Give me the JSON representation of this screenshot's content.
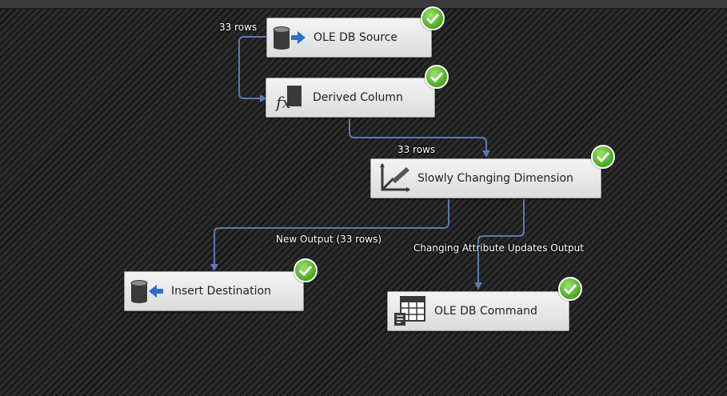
{
  "components": {
    "oledb_source": "OLE DB Source",
    "derived_column": "Derived Column",
    "scd": "Slowly Changing Dimension",
    "insert_destination": "Insert Destination",
    "oledb_command": "OLE DB Command"
  },
  "paths": {
    "source_to_derived": "33 rows",
    "derived_to_scd": "33 rows",
    "scd_to_insert": "New Output (33 rows)",
    "scd_to_command": "Changing Attribute Updates Output"
  },
  "icons": {
    "oledb_source": "database-source-icon",
    "derived_column": "fx-function-icon",
    "scd": "dimension-chart-icon",
    "insert_destination": "database-destination-icon",
    "oledb_command": "table-command-icon",
    "status": "success-check-icon"
  },
  "colors": {
    "path_line": "#5b7ab0",
    "success": "#4aa51e"
  }
}
